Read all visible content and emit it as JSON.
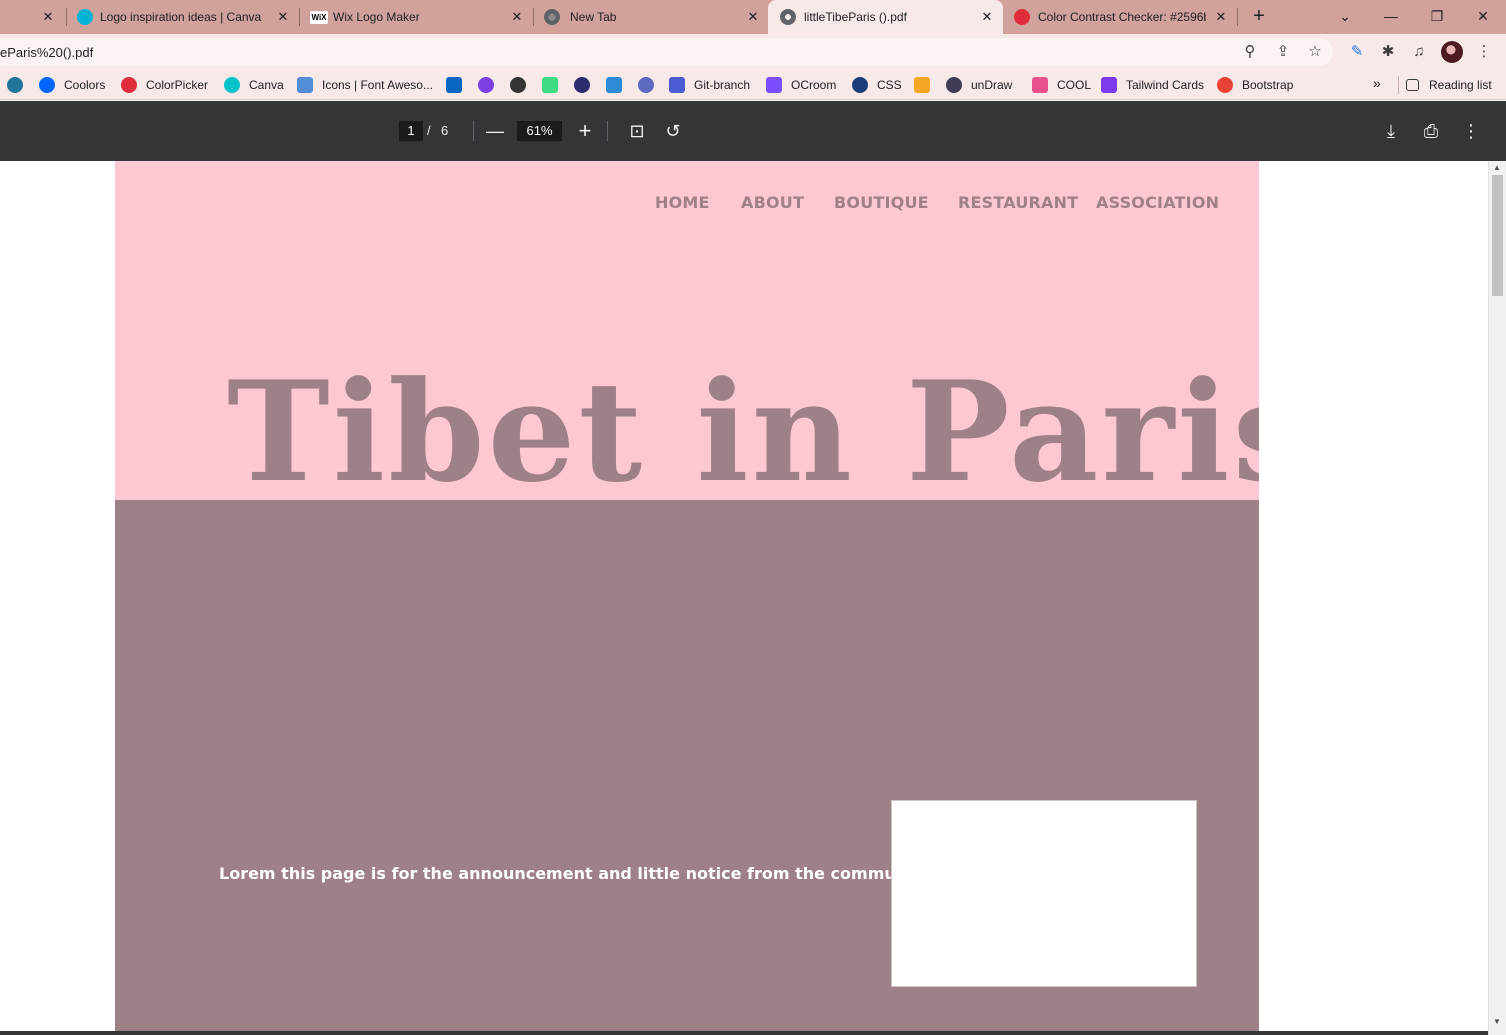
{
  "browser": {
    "tabs": [
      {
        "title": "",
        "active": false
      },
      {
        "title": "Logo inspiration ideas | Canva",
        "active": false,
        "icon": "canva-icon"
      },
      {
        "title": "Wix Logo Maker",
        "active": false,
        "icon": "wix-icon"
      },
      {
        "title": "New Tab",
        "active": false,
        "icon": "chrome-icon"
      },
      {
        "title": "littleTibeParis ().pdf",
        "active": true,
        "icon": "globe-icon"
      },
      {
        "title": "Color Contrast Checker: #2596b",
        "active": false,
        "icon": "colorpicker-icon"
      }
    ],
    "new_tab_label": "+",
    "url": "eParis%20().pdf",
    "bookmarks": [
      {
        "label": "",
        "icon": "wordpress-icon",
        "color": "#21759b"
      },
      {
        "label": "Coolors",
        "icon": "coolors-icon",
        "color": "#0066ff"
      },
      {
        "label": "ColorPicker",
        "icon": "colorpicker-icon",
        "color": "#e02d3c"
      },
      {
        "label": "Canva",
        "icon": "canva-icon",
        "color": "#00c4cc"
      },
      {
        "label": "Icons | Font Aweso...",
        "icon": "flag-icon",
        "color": "#528dd7"
      },
      {
        "label": "",
        "icon": "linkedin-icon",
        "color": "#0a66c2"
      },
      {
        "label": "",
        "icon": "upwork-icon",
        "color": "#7b3fe4"
      },
      {
        "label": "",
        "icon": "github-icon",
        "color": "#333333"
      },
      {
        "label": "",
        "icon": "android-icon",
        "color": "#3ddc84"
      },
      {
        "label": "",
        "icon": "cssbuddy-icon",
        "color": "#2d2d6e"
      },
      {
        "label": "",
        "icon": "app-icon",
        "color": "#2f8bd6"
      },
      {
        "label": "",
        "icon": "wordpress-alt-icon",
        "color": "#5c6bc0"
      },
      {
        "label": "Git-branch",
        "icon": "git-branch-icon",
        "color": "#4c5bd4"
      },
      {
        "label": "OCroom",
        "icon": "ocroom-icon",
        "color": "#7c4dff"
      },
      {
        "label": "CSS",
        "icon": "css-icon",
        "color": "#1c3d7a"
      },
      {
        "label": "",
        "icon": "w-icon",
        "color": "#f5a623"
      },
      {
        "label": "unDraw",
        "icon": "undraw-icon",
        "color": "#3f3d56"
      },
      {
        "label": "COOL",
        "icon": "cool-icon",
        "color": "#e94f8a"
      },
      {
        "label": "Tailwind Cards",
        "icon": "vue-icon",
        "color": "#7c3aed"
      },
      {
        "label": "Bootstrap",
        "icon": "google-icon",
        "color": "#ea4335"
      }
    ],
    "more_bookmarks": "»",
    "reading_list": "Reading list"
  },
  "pdf_viewer": {
    "current_page": "1",
    "page_separator": "/",
    "total_pages": "6",
    "zoom": "61%"
  },
  "document": {
    "nav": [
      "HOME",
      "ABOUT",
      "BOUTIQUE",
      "RESTAURANT",
      "ASSOCIATION"
    ],
    "hero_title": "Tibet in Paris",
    "notice": "Lorem this page is for the announcement and little notice from the community",
    "colors": {
      "pink": "#fec8d3",
      "mauve": "#9e8087",
      "white": "#ffffff"
    }
  }
}
